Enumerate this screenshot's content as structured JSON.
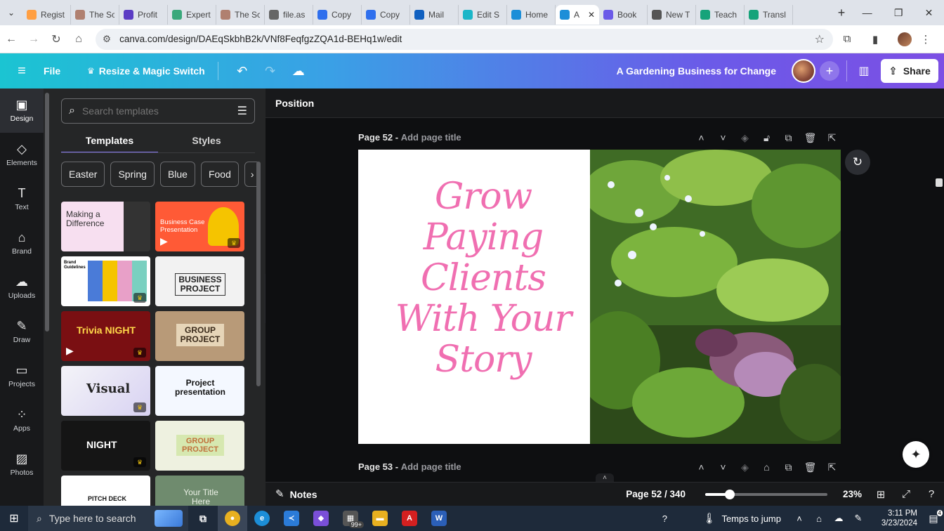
{
  "browser": {
    "tabs": [
      {
        "title": "Regist",
        "color": "#ff9f43"
      },
      {
        "title": "The Sc",
        "color": "#b08070"
      },
      {
        "title": "Profit",
        "color": "#5b3cc4"
      },
      {
        "title": "Expert",
        "color": "#3aa87b"
      },
      {
        "title": "The Sc",
        "color": "#b08070"
      },
      {
        "title": "file.as",
        "color": "#666666"
      },
      {
        "title": "Copy",
        "color": "#2f6fed"
      },
      {
        "title": "Copy",
        "color": "#2f6fed"
      },
      {
        "title": "Mail",
        "color": "#1060c0"
      },
      {
        "title": "Edit S",
        "color": "#1bb6c8"
      },
      {
        "title": "Home",
        "color": "#1c8ed8"
      },
      {
        "title": "A",
        "color": "#1c8ed8",
        "active": true
      },
      {
        "title": "Book",
        "color": "#6b5ae8"
      },
      {
        "title": "New T",
        "color": "#555555"
      },
      {
        "title": "Teach",
        "color": "#16a37a"
      },
      {
        "title": "Transl",
        "color": "#16a37a"
      }
    ],
    "url": "canva.com/design/DAEqSkbhB2k/VNf8FeqfgzZQA1d-BEHq1w/edit"
  },
  "header": {
    "menu_label": "File",
    "resize_label": "Resize & Magic Switch",
    "doc_title": "A Gardening Business for Change",
    "share_label": "Share"
  },
  "rail": {
    "items": [
      {
        "label": "Design",
        "icon": "▣"
      },
      {
        "label": "Elements",
        "icon": "◇"
      },
      {
        "label": "Text",
        "icon": "T"
      },
      {
        "label": "Brand",
        "icon": "⌂"
      },
      {
        "label": "Uploads",
        "icon": "☁"
      },
      {
        "label": "Draw",
        "icon": "✎"
      },
      {
        "label": "Projects",
        "icon": "▭"
      },
      {
        "label": "Apps",
        "icon": "⁘"
      },
      {
        "label": "Photos",
        "icon": "▨"
      }
    ]
  },
  "panel": {
    "search_placeholder": "Search templates",
    "tabs": [
      "Templates",
      "Styles"
    ],
    "chips": [
      "Easter",
      "Spring",
      "Blue",
      "Food"
    ],
    "templates": [
      {
        "text": "Making a Difference"
      },
      {
        "text": "Business Case Presentation"
      },
      {
        "text": "Brand Guidelines"
      },
      {
        "text": "BUSINESS PROJECT"
      },
      {
        "text": "Trivia NIGHT"
      },
      {
        "text": "GROUP PROJECT"
      },
      {
        "text": "Visual"
      },
      {
        "text": "Project presentation"
      },
      {
        "text": "NIGHT"
      },
      {
        "text": "GROUP PROJECT"
      },
      {
        "text": "PITCH DECK"
      },
      {
        "text": "Your Title Here"
      }
    ]
  },
  "editor": {
    "toolbar_label": "Position",
    "page52": {
      "name": "Page 52 -",
      "add_title": "Add page title"
    },
    "page53": {
      "name": "Page 53 -",
      "add_title": "Add page title"
    },
    "slide_title": "Grow Paying Clients With Your Story"
  },
  "bottombar": {
    "notes_label": "Notes",
    "page_indicator": "Page 52 / 340",
    "zoom": "23%",
    "zoom_fraction": 0.2
  },
  "taskbar": {
    "search_placeholder": "Type here to search",
    "weather": "Temps to jump",
    "time": "3:11 PM",
    "date": "3/23/2024",
    "badge": "99+",
    "notif_count": "4"
  }
}
